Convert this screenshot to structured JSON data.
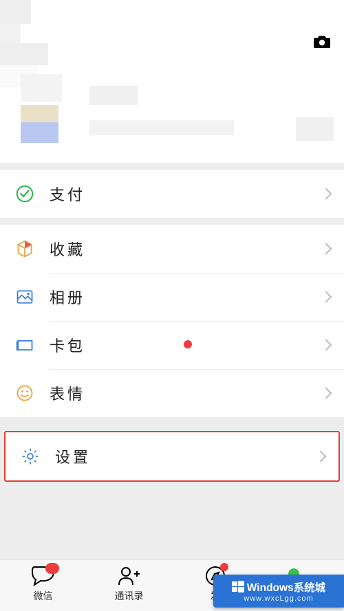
{
  "menu": {
    "pay": "支付",
    "favorites": "收藏",
    "album": "相册",
    "cards": "卡包",
    "stickers": "表情",
    "settings": "设置"
  },
  "tabs": {
    "chats": "微信",
    "contacts": "通讯录",
    "discover_partial": "发"
  },
  "watermark": {
    "title": "Windows系统城",
    "url": "www.wxcLgg.com"
  }
}
